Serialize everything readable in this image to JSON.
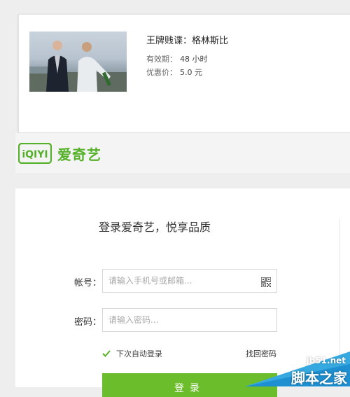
{
  "product": {
    "title": "王牌贱谍：格林斯比",
    "validity_label": "有效期：",
    "validity_value": "48 小时",
    "price_label": "优惠价：",
    "price_value": "5.0 元"
  },
  "brand": {
    "logo_mark": "iQIYI",
    "name": "爱奇艺",
    "color": "#56b12a"
  },
  "login": {
    "title": "登录爱奇艺，悦享品质",
    "account_label": "帐号：",
    "account_placeholder": "请输入手机号或邮箱...",
    "password_label": "密码：",
    "password_placeholder": "请输入密码...",
    "auto_login": "下次自动登录",
    "forgot": "找回密码",
    "submit": "登录",
    "button_color": "#6cbd2b"
  },
  "watermark": {
    "url": "jb51.net",
    "name": "脚本之家"
  },
  "icons": {
    "qr": "qr-code-icon",
    "check": "checkbox-checked-icon"
  }
}
